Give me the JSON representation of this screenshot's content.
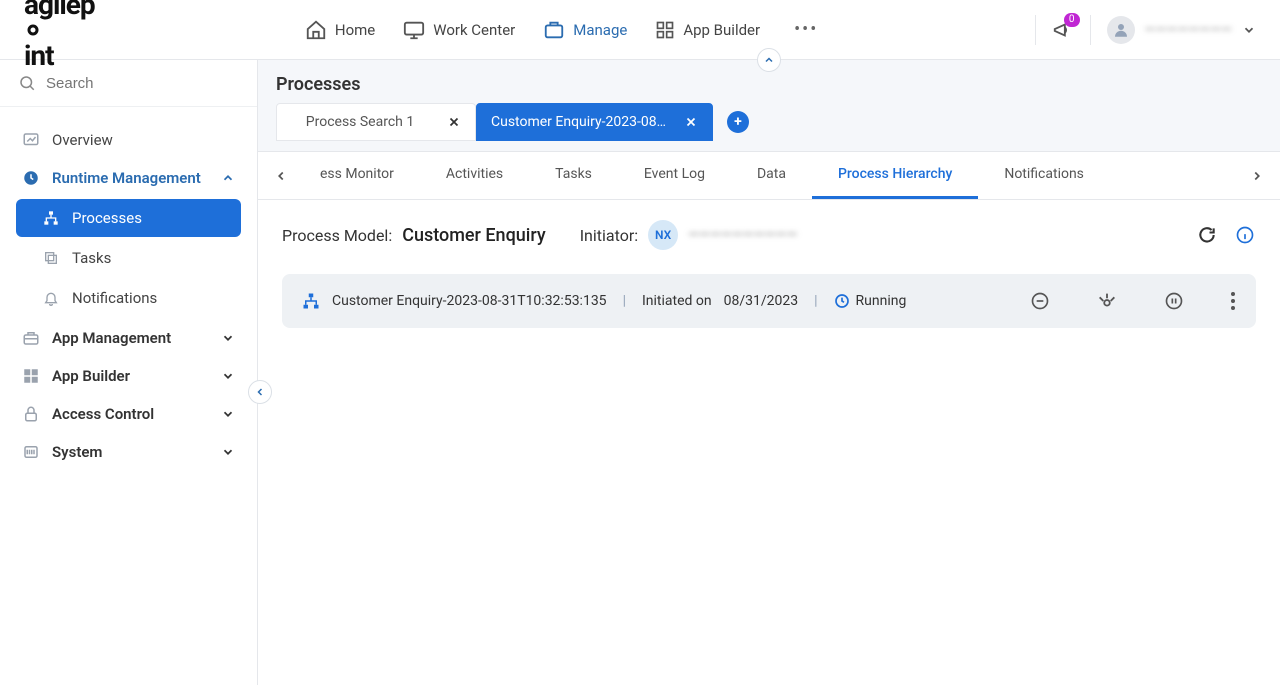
{
  "header": {
    "brand_prefix": "agilep",
    "brand_suffix": "int",
    "nav": [
      {
        "label": "Home",
        "icon": "home-icon",
        "active": false
      },
      {
        "label": "Work Center",
        "icon": "monitor-icon",
        "active": false
      },
      {
        "label": "Manage",
        "icon": "briefcase-icon",
        "active": true
      },
      {
        "label": "App Builder",
        "icon": "grid-icon",
        "active": false
      }
    ],
    "notification_count": "0",
    "username": "————————"
  },
  "sidebar": {
    "search_placeholder": "Search",
    "items": {
      "overview": "Overview",
      "runtime": "Runtime Management",
      "runtime_children": {
        "processes": "Processes",
        "tasks": "Tasks",
        "notifications": "Notifications"
      },
      "app_management": "App Management",
      "app_builder": "App Builder",
      "access_control": "Access Control",
      "system": "System"
    }
  },
  "main": {
    "title": "Processes",
    "tabs": [
      {
        "label": "Process Search 1",
        "active": false
      },
      {
        "label": "Customer Enquiry-2023-08…",
        "active": true
      }
    ],
    "filter_tabs": [
      {
        "label": "ess Monitor",
        "active": false
      },
      {
        "label": "Activities",
        "active": false
      },
      {
        "label": "Tasks",
        "active": false
      },
      {
        "label": "Event Log",
        "active": false
      },
      {
        "label": "Data",
        "active": false
      },
      {
        "label": "Process Hierarchy",
        "active": true
      },
      {
        "label": "Notifications",
        "active": false
      }
    ],
    "model": {
      "label": "Process Model:",
      "name": "Customer Enquiry",
      "initiator_label": "Initiator:",
      "initiator_badge": "NX",
      "initiator_name": "——————————"
    },
    "process": {
      "name": "Customer Enquiry-2023-08-31T10:32:53:135",
      "initiated_label": "Initiated on",
      "initiated_date": "08/31/2023",
      "status": "Running"
    }
  }
}
